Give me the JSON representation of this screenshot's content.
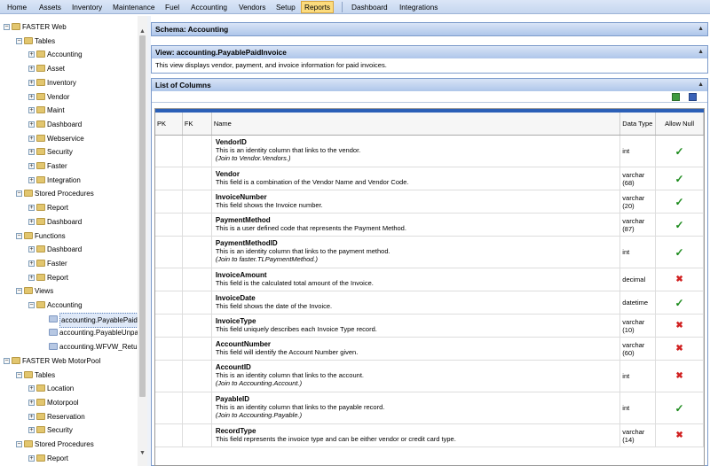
{
  "menu": [
    "Home",
    "Assets",
    "Inventory",
    "Maintenance",
    "Fuel",
    "Accounting",
    "Vendors",
    "Setup",
    "Reports",
    "Dashboard",
    "Integrations"
  ],
  "menu_active": "Reports",
  "tree": {
    "nodes": [
      {
        "label": "FASTER Web",
        "icon": "root"
      },
      {
        "label": "Tables",
        "icon": "folder"
      },
      {
        "label": "Accounting",
        "icon": "folder"
      },
      {
        "label": "Asset",
        "icon": "folder"
      },
      {
        "label": "Inventory",
        "icon": "folder"
      },
      {
        "label": "Vendor",
        "icon": "folder"
      },
      {
        "label": "Maint",
        "icon": "folder"
      },
      {
        "label": "Dashboard",
        "icon": "folder"
      },
      {
        "label": "Webservice",
        "icon": "folder"
      },
      {
        "label": "Security",
        "icon": "folder"
      },
      {
        "label": "Faster",
        "icon": "folder"
      },
      {
        "label": "Integration",
        "icon": "folder"
      },
      {
        "label": "Stored Procedures",
        "icon": "folder"
      },
      {
        "label": "Report",
        "icon": "folder"
      },
      {
        "label": "Dashboard",
        "icon": "folder"
      },
      {
        "label": "Functions",
        "icon": "folder"
      },
      {
        "label": "Dashboard",
        "icon": "folder"
      },
      {
        "label": "Faster",
        "icon": "folder"
      },
      {
        "label": "Report",
        "icon": "folder"
      },
      {
        "label": "Views",
        "icon": "folder"
      },
      {
        "label": "Accounting",
        "icon": "folder"
      },
      {
        "label": "accounting.PayablePaidInvoice",
        "icon": "view"
      },
      {
        "label": "accounting.PayableUnpaidInvoice",
        "icon": "view"
      },
      {
        "label": "accounting.WFVW_Returns",
        "icon": "view"
      },
      {
        "label": "FASTER Web MotorPool",
        "icon": "root"
      },
      {
        "label": "Tables",
        "icon": "folder"
      },
      {
        "label": "Location",
        "icon": "folder"
      },
      {
        "label": "Motorpool",
        "icon": "folder"
      },
      {
        "label": "Reservation",
        "icon": "folder"
      },
      {
        "label": "Security",
        "icon": "folder"
      },
      {
        "label": "Stored Procedures",
        "icon": "folder"
      },
      {
        "label": "Report",
        "icon": "folder"
      }
    ]
  },
  "schema_panel": {
    "title": "Schema: Accounting"
  },
  "view_panel": {
    "title": "View: accounting.PayablePaidInvoice",
    "description": "This view displays vendor, payment, and invoice information for paid invoices."
  },
  "columns_panel": {
    "title": "List of Columns",
    "toolbar_icons": [
      "export-excel-icon",
      "export-word-icon"
    ]
  },
  "grid": {
    "headers": {
      "pk": "PK",
      "fk": "FK",
      "name": "Name",
      "type": "Data Type",
      "null": "Allow Null"
    },
    "rows": [
      {
        "name": "VendorID",
        "desc": "This is an identity column that links to the vendor.",
        "join": "(Join to Vendor.Vendors.)",
        "type": "int",
        "null": "yes"
      },
      {
        "name": "Vendor",
        "desc": "This field is a combination of the Vendor Name and Vendor Code.",
        "join": "",
        "type": "varchar (68)",
        "null": "yes"
      },
      {
        "name": "InvoiceNumber",
        "desc": "This field shows the Invoice number.",
        "join": "",
        "type": "varchar (20)",
        "null": "yes"
      },
      {
        "name": "PaymentMethod",
        "desc": "This is a user defined code that represents the Payment Method.",
        "join": "",
        "type": "varchar (87)",
        "null": "yes"
      },
      {
        "name": "PaymentMethodID",
        "desc": "This is an identity column that links to the payment method.",
        "join": "(Join to faster.TLPaymentMethod.)",
        "type": "int",
        "null": "yes"
      },
      {
        "name": "InvoiceAmount",
        "desc": "This field is the calculated total amount of the Invoice.",
        "join": "",
        "type": "decimal",
        "null": "no"
      },
      {
        "name": "InvoiceDate",
        "desc": "This field shows the date of the Invoice.",
        "join": "",
        "type": "datetime",
        "null": "yes"
      },
      {
        "name": "InvoiceType",
        "desc": "This field uniquely describes each Invoice Type record.",
        "join": "",
        "type": "varchar (10)",
        "null": "no"
      },
      {
        "name": "AccountNumber",
        "desc": "This field will identify the Account Number given.",
        "join": "",
        "type": "varchar (60)",
        "null": "no"
      },
      {
        "name": "AccountID",
        "desc": "This is an identity column that links to the account.",
        "join": "(Join to Accounting.Account.)",
        "type": "int",
        "null": "no"
      },
      {
        "name": "PayableID",
        "desc": "This is an identity column that links to the payable record.",
        "join": "(Join to Accounting.Payable.)",
        "type": "int",
        "null": "yes"
      },
      {
        "name": "RecordType",
        "desc": "This field represents the invoice type and can be either vendor or credit card type.",
        "join": "",
        "type": "varchar (14)",
        "null": "no"
      }
    ]
  },
  "colors": {
    "accent": "#2b5fb7",
    "check": "#1b8a1b",
    "cross": "#d12222"
  }
}
